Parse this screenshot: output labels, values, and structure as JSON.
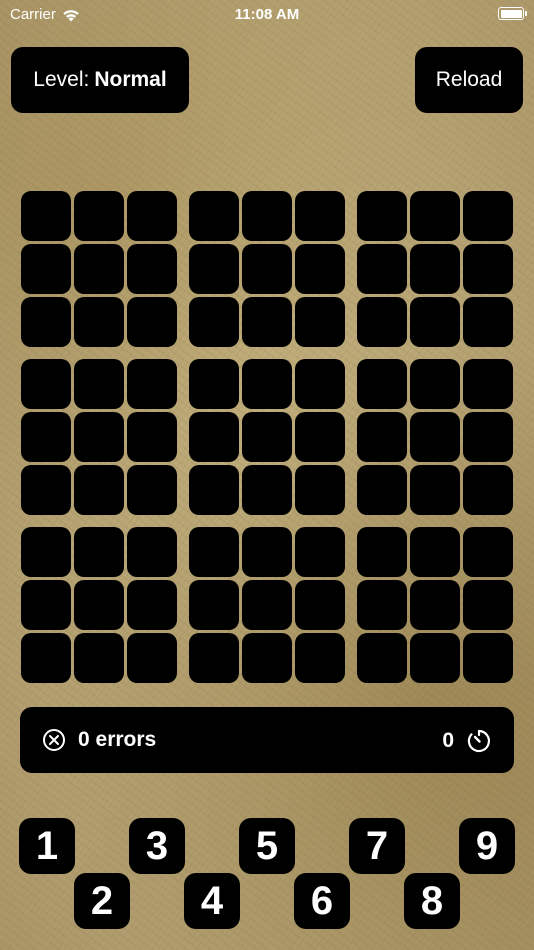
{
  "status_bar": {
    "carrier": "Carrier",
    "time": "11:08 AM",
    "wifi_icon": "wifi-icon",
    "battery_icon": "battery-icon"
  },
  "header": {
    "level_label": "Level:",
    "level_value": "Normal",
    "reload_label": "Reload"
  },
  "board": {
    "rows": 9,
    "cols": 9,
    "cells": [
      [
        "",
        "",
        "",
        "",
        "",
        "",
        "",
        "",
        ""
      ],
      [
        "",
        "",
        "",
        "",
        "",
        "",
        "",
        "",
        ""
      ],
      [
        "",
        "",
        "",
        "",
        "",
        "",
        "",
        "",
        ""
      ],
      [
        "",
        "",
        "",
        "",
        "",
        "",
        "",
        "",
        ""
      ],
      [
        "",
        "",
        "",
        "",
        "",
        "",
        "",
        "",
        ""
      ],
      [
        "",
        "",
        "",
        "",
        "",
        "",
        "",
        "",
        ""
      ],
      [
        "",
        "",
        "",
        "",
        "",
        "",
        "",
        "",
        ""
      ],
      [
        "",
        "",
        "",
        "",
        "",
        "",
        "",
        "",
        ""
      ],
      [
        "",
        "",
        "",
        "",
        "",
        "",
        "",
        "",
        ""
      ]
    ]
  },
  "info": {
    "errors_text": "0 errors",
    "timer_value": "0",
    "errors_icon": "x-circle-icon",
    "timer_icon": "timer-icon"
  },
  "keypad": [
    "1",
    "2",
    "3",
    "4",
    "5",
    "6",
    "7",
    "8",
    "9"
  ]
}
